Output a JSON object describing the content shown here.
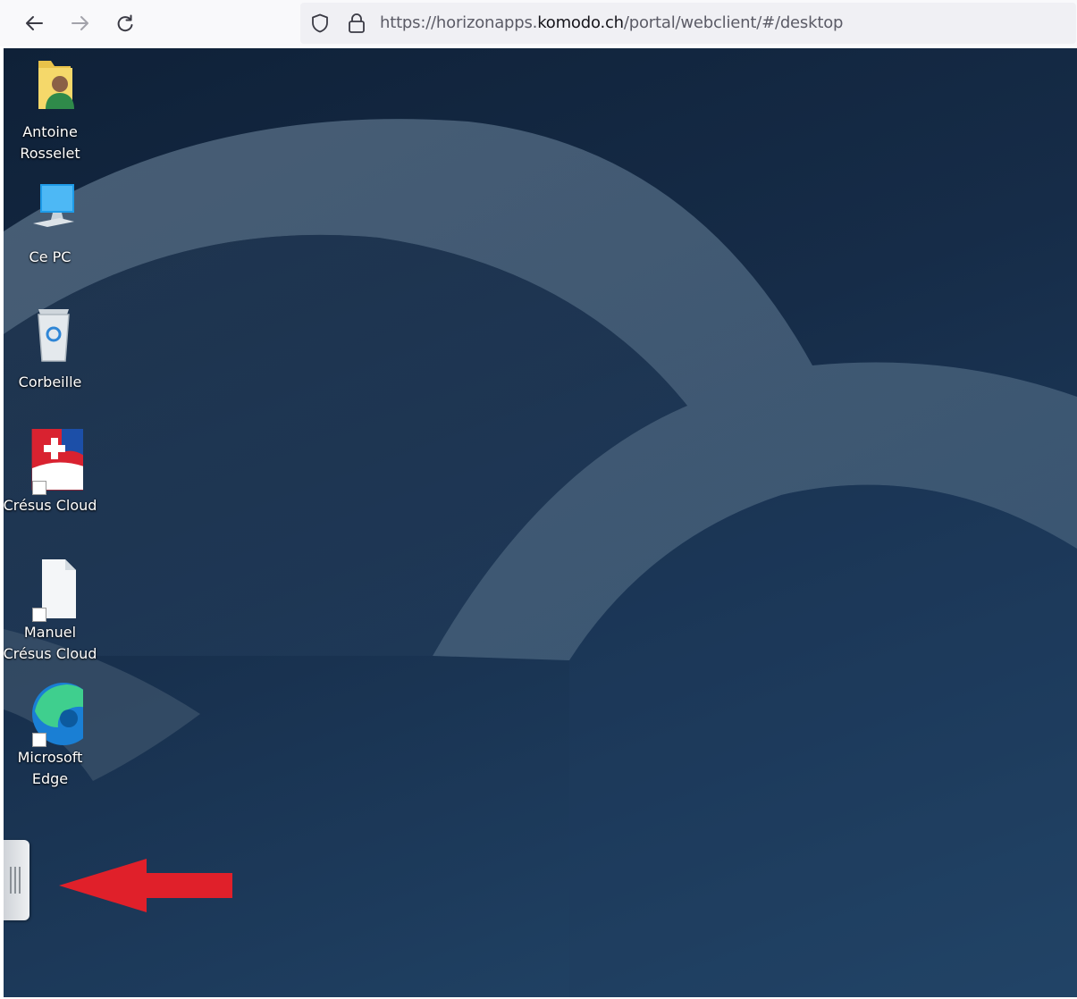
{
  "browser": {
    "back_icon": "arrow-left-icon",
    "forward_icon": "arrow-right-icon",
    "reload_icon": "reload-icon",
    "url": {
      "prefix": "https://horizonapps.",
      "domain": "komodo.ch",
      "path": "/portal/webclient/#/desktop"
    }
  },
  "desktop": {
    "icons": [
      {
        "label": "Antoine\nRosselet",
        "icon": "user-folder-icon"
      },
      {
        "label": "Ce PC",
        "icon": "computer-icon"
      },
      {
        "label": "Corbeille",
        "icon": "recycle-bin-icon"
      },
      {
        "label": "Crésus Cloud",
        "icon": "cresus-cloud-icon"
      },
      {
        "label": "Manuel\nCrésus Cloud",
        "icon": "document-icon"
      },
      {
        "label": "Microsoft\nEdge",
        "icon": "edge-icon"
      }
    ],
    "sidebar_handle_icon": "grip-handle-icon",
    "annotation_icon": "red-arrow-icon",
    "colors": {
      "annotation": "#e0202a",
      "wallpaper_dark": "#0f2138",
      "wallpaper_light": "#23486b"
    }
  }
}
